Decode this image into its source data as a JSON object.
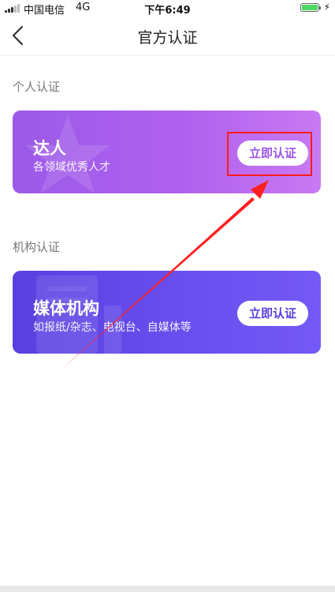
{
  "status_bar": {
    "carrier": "中国电信",
    "network": "4G",
    "time": "下午6:49",
    "battery_color": "#4cd964"
  },
  "nav": {
    "back_icon": "chevron-left-icon",
    "title": "官方认证"
  },
  "sections": [
    {
      "title": "个人认证",
      "card": {
        "title": "达人",
        "subtitle": "各领域优秀人才",
        "button_label": "立即认证",
        "gradient": [
          "#9b5ae8",
          "#c87af3"
        ],
        "decoration_icon": "star-icon"
      }
    },
    {
      "title": "机构认证",
      "card": {
        "title": "媒体机构",
        "subtitle": "如报纸/杂志、电视台、自媒体等",
        "button_label": "立即认证",
        "gradient": [
          "#5a3fe0",
          "#7459f6"
        ],
        "decoration_icon": "building-icon"
      }
    }
  ],
  "annotation": {
    "highlight_color": "#ff1a1a",
    "arrow_icon": "arrow-icon"
  }
}
